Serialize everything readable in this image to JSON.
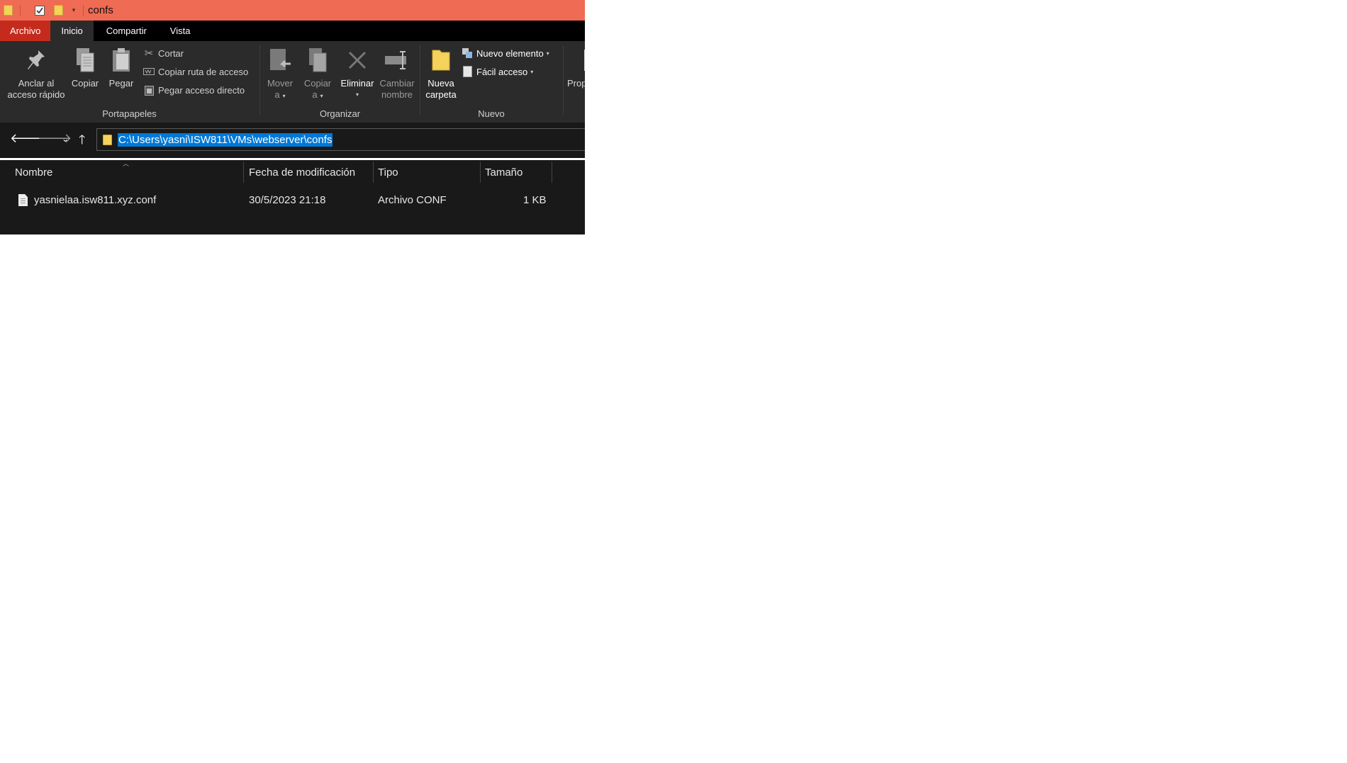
{
  "window": {
    "title": "confs"
  },
  "ribbon_tabs": [
    {
      "label": "Archivo"
    },
    {
      "label": "Inicio"
    },
    {
      "label": "Compartir"
    },
    {
      "label": "Vista"
    }
  ],
  "ribbon": {
    "portapapeles": {
      "group_label": "Portapapeles",
      "pin": {
        "line1": "Anclar al",
        "line2": "acceso rápido"
      },
      "copy": "Copiar",
      "paste": "Pegar",
      "cut": "Cortar",
      "copy_path": "Copiar ruta de acceso",
      "paste_shortcut": "Pegar acceso directo"
    },
    "organizar": {
      "group_label": "Organizar",
      "move": {
        "line1": "Mover",
        "line2": "a"
      },
      "copy_to": {
        "line1": "Copiar",
        "line2": "a"
      },
      "delete": "Eliminar",
      "rename": {
        "line1": "Cambiar",
        "line2": "nombre"
      }
    },
    "nuevo": {
      "group_label": "Nuevo",
      "new_folder": {
        "line1": "Nueva",
        "line2": "carpeta"
      },
      "new_item": "Nuevo elemento",
      "easy_access": "Fácil acceso"
    },
    "abrir": {
      "properties_partial": "Prop"
    }
  },
  "address_bar": {
    "path": "C:\\Users\\yasni\\ISW811\\VMs\\webserver\\confs"
  },
  "columns": [
    {
      "label": "Nombre"
    },
    {
      "label": "Fecha de modificación"
    },
    {
      "label": "Tipo"
    },
    {
      "label": "Tamaño"
    }
  ],
  "files": [
    {
      "name": "yasnielaa.isw811.xyz.conf",
      "modified": "30/5/2023 21:18",
      "type": "Archivo CONF",
      "size": "1 KB"
    }
  ],
  "colors": {
    "titlebar": "#f06b53",
    "file_tab": "#c42b1c",
    "ribbon_bg": "#2b2b2b",
    "window_bg": "#191919",
    "selection": "#0078d7",
    "folder": "#f5d25a"
  }
}
